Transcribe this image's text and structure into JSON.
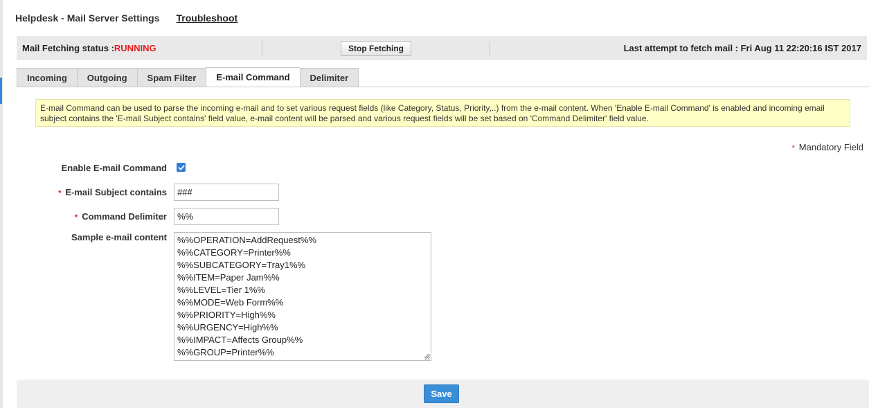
{
  "header": {
    "title": "Helpdesk - Mail Server Settings",
    "troubleshoot_link": "Troubleshoot"
  },
  "status_bar": {
    "status_label": "Mail Fetching status :",
    "status_value": "RUNNING",
    "stop_button": "Stop Fetching",
    "last_attempt": "Last attempt to fetch mail : Fri Aug 11 22:20:16 IST 2017"
  },
  "tabs": [
    {
      "label": "Incoming",
      "active": false
    },
    {
      "label": "Outgoing",
      "active": false
    },
    {
      "label": "Spam Filter",
      "active": false
    },
    {
      "label": "E-mail Command",
      "active": true
    },
    {
      "label": "Delimiter",
      "active": false
    }
  ],
  "info_text": "E-mail Command can be used to parse the incoming e-mail and to set various request fields (like Category, Status, Priority,..) from the e-mail content. When 'Enable E-mail Command' is enabled and incoming email subject contains the 'E-mail Subject contains' field value, e-mail content will be parsed and various request fields will be set based on 'Command Delimiter' field value.",
  "mandatory_note": "Mandatory Field",
  "required_marker": "*",
  "form": {
    "enable_label": "Enable E-mail Command",
    "enable_checked": true,
    "subject_label": "E-mail Subject contains",
    "subject_value": "###",
    "delimiter_label": "Command Delimiter",
    "delimiter_value": "%%",
    "sample_label": "Sample e-mail content",
    "sample_lines": [
      "%%OPERATION=AddRequest%%",
      "%%CATEGORY=Printer%%",
      "%%SUBCATEGORY=Tray1%%",
      "%%ITEM=Paper Jam%%",
      "%%LEVEL=Tier 1%%",
      "%%MODE=Web Form%%",
      "%%PRIORITY=High%%",
      "%%URGENCY=High%%",
      "%%IMPACT=Affects Group%%",
      "%%GROUP=Printer%%"
    ]
  },
  "save_button": "Save",
  "colors": {
    "accent": "#3b8fd6",
    "running": "#e02020",
    "info_bg": "#ffffc6",
    "status_bar_bg": "#e9e9e9"
  }
}
